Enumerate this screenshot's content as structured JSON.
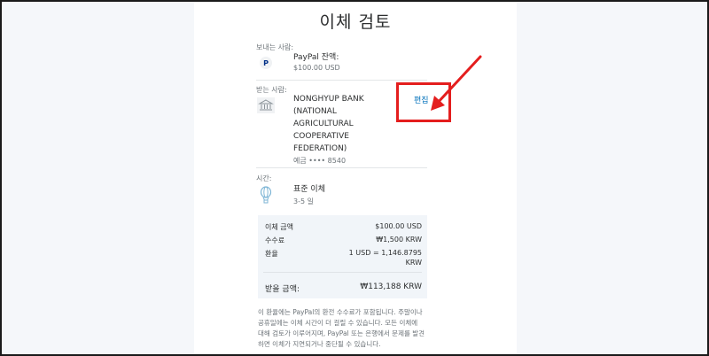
{
  "page": {
    "title": "이체 검토"
  },
  "sender": {
    "label": "보내는 사람:",
    "icon": "paypal-icon",
    "icon_text": "P",
    "name": "PayPal 잔액:",
    "amount": "$100.00 USD"
  },
  "recipient": {
    "label": "받는 사람:",
    "icon": "bank-icon",
    "bank_lines": [
      "NONGHYUP BANK",
      "(NATIONAL",
      "AGRICULTURAL",
      "COOPERATIVE",
      "FEDERATION)"
    ],
    "account": "예금 •••• 8540",
    "edit_label": "편집"
  },
  "timing": {
    "label": "시간:",
    "icon": "balloon-icon",
    "type": "표준 이체",
    "duration": "3-5 일"
  },
  "summary": {
    "transfer_amount_label": "이체 금액",
    "transfer_amount_value": "$100.00 USD",
    "fee_label": "수수료",
    "fee_value": "₩1,500 KRW",
    "rate_label": "환율",
    "rate_value_line1": "1 USD = 1,146.8795",
    "rate_value_line2": "KRW",
    "receive_label": "받을 금액:",
    "receive_value": "₩113,188 KRW"
  },
  "disclaimer": [
    "이 환율에는 PayPal의 환전 수수료가 포함됩니다. 주말이나",
    "공휴일에는 이체 시간이 더 걸릴 수 있습니다. 모든 이체에",
    "대해 검토가 이루어지며, PayPal 또는 은행에서 문제를 발견",
    "하면 이체가 지연되거나 중단될 수 있습니다."
  ],
  "annotation": {
    "color": "#e41e1e"
  },
  "colors": {
    "link": "#0070ba",
    "summary_bg": "#f1f5f9",
    "page_bg": "#f5f7fa"
  }
}
